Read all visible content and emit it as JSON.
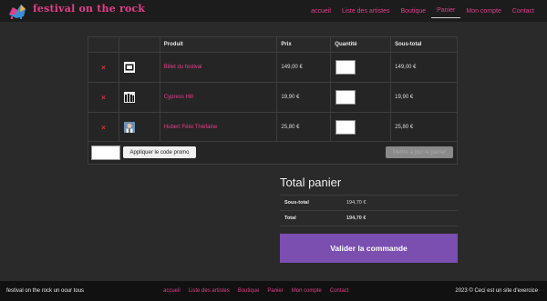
{
  "header": {
    "logo_text": "festival on the rock",
    "nav": [
      "accueil",
      "Liste des artistes",
      "Boutique",
      "Panier",
      "Mon compte",
      "Contact"
    ],
    "active_nav": "Panier"
  },
  "cart": {
    "columns": {
      "product": "Produit",
      "price": "Prix",
      "quantity": "Quantité",
      "subtotal": "Sous-total"
    },
    "remove_icon": "×",
    "rows": [
      {
        "product": "Billet du festival",
        "price": "149,00 €",
        "subtotal": "149,00 €",
        "thumb_icon": "ticket-icon"
      },
      {
        "product": "Cypress Hill",
        "price": "19,90 €",
        "subtotal": "19,90 €",
        "thumb_icon": "band-photo"
      },
      {
        "product": "Hubert Félix Thiéfaine",
        "price": "25,80 €",
        "subtotal": "25,80 €",
        "thumb_icon": "artist-photo"
      }
    ],
    "coupon_button": "Appliquer le code promo",
    "update_button": "Mettre à jour le panier"
  },
  "totals": {
    "title": "Total panier",
    "subtotal_label": "Sous-total",
    "subtotal_value": "194,70 €",
    "total_label": "Total",
    "total_value": "194,70 €",
    "checkout_button": "Valider la commande"
  },
  "footer": {
    "left": "festival on the rock un oour tous",
    "nav": [
      "accueil",
      "Liste des artistes",
      "Boutique",
      "Panier",
      "Mon compte",
      "Contact"
    ],
    "right": "2023 © Ceci est un site d'exercice"
  },
  "colors": {
    "accent": "#e03f8a",
    "checkout": "#7a4fb0",
    "remove": "#d6393a",
    "background": "#2b2a2a"
  }
}
